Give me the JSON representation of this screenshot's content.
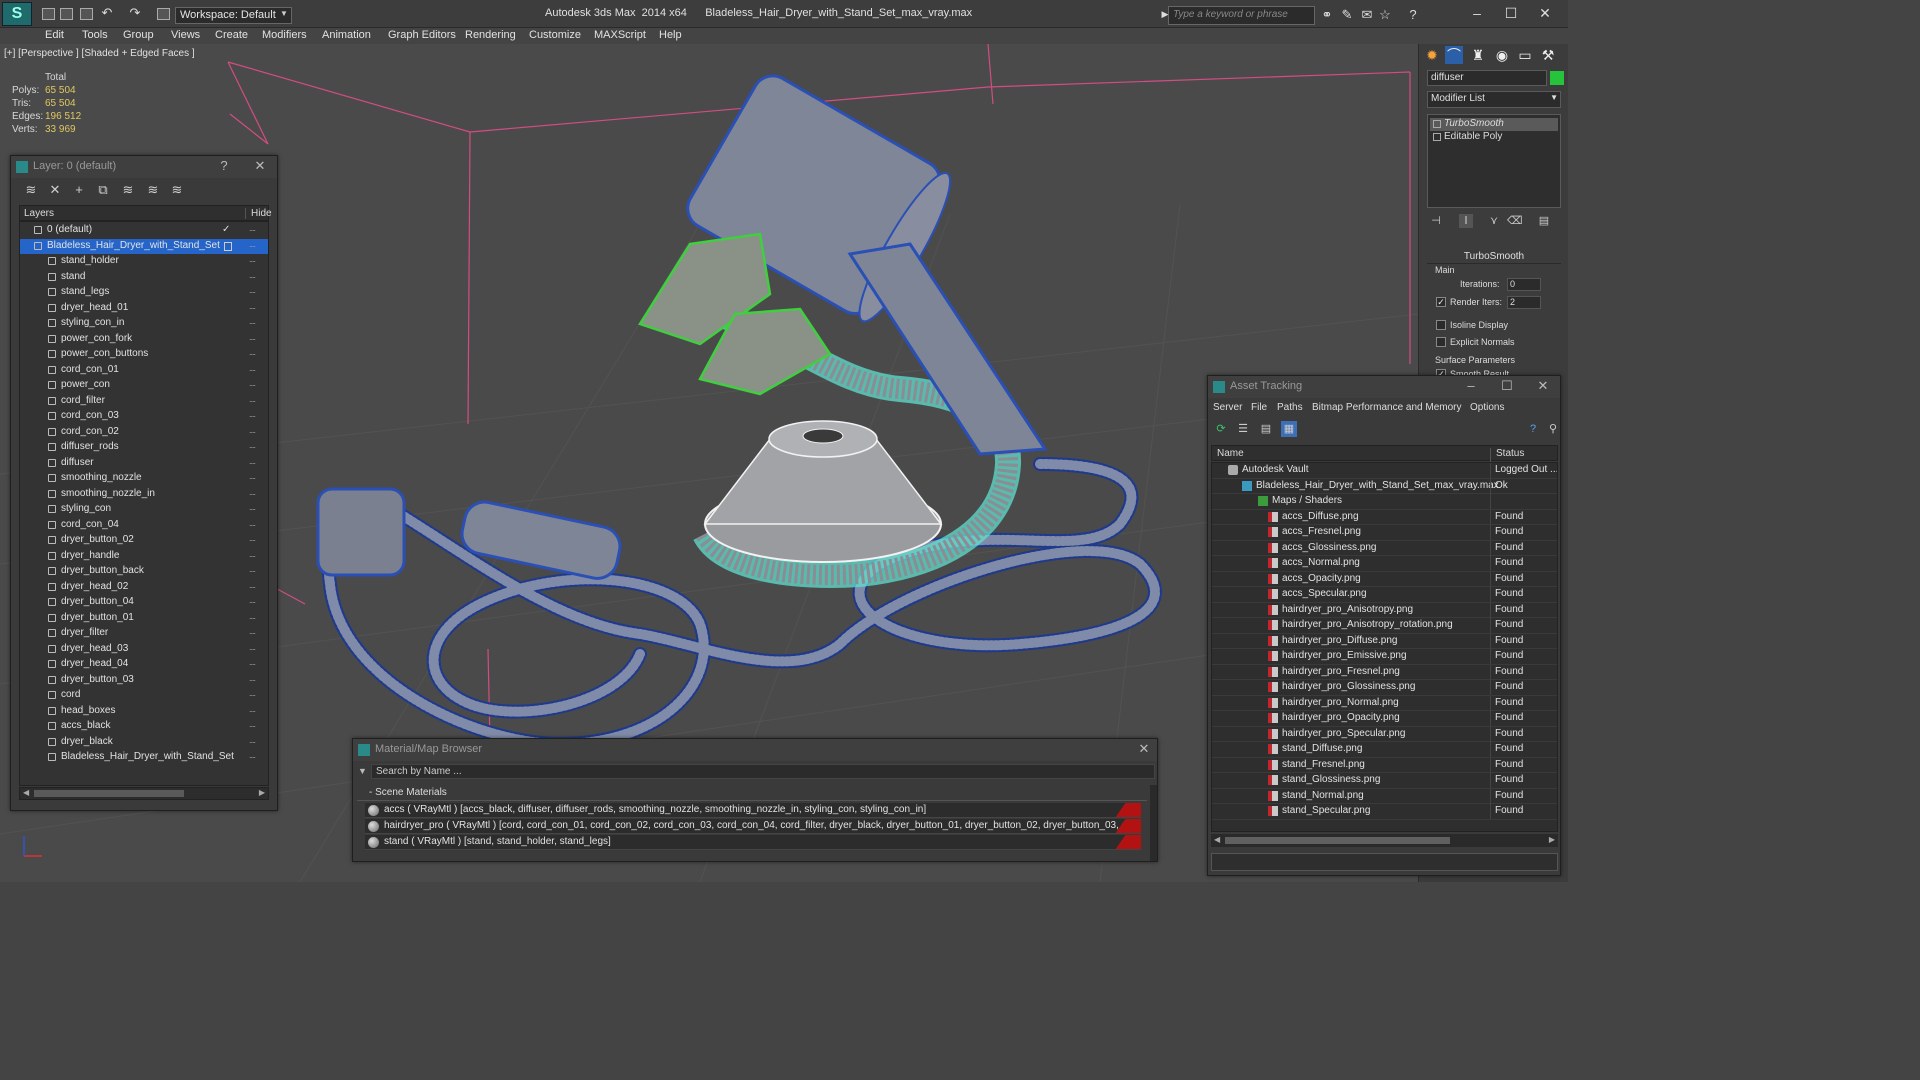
{
  "app": {
    "title": "Autodesk 3ds Max  2014 x64      Bladeless_Hair_Dryer_with_Stand_Set_max_vray.max",
    "workspace": "Workspace: Default",
    "search_placeholder": "Type a keyword or phrase"
  },
  "menu": [
    "Edit",
    "Tools",
    "Group",
    "Views",
    "Create",
    "Modifiers",
    "Animation",
    "Graph Editors",
    "Rendering",
    "Customize",
    "MAXScript",
    "Help"
  ],
  "viewport": {
    "label": "[+] [Perspective ] [Shaded + Edged Faces ]",
    "stats": {
      "header": "Total",
      "rows": [
        {
          "key": "Polys:",
          "value": "65 504"
        },
        {
          "key": "Tris:",
          "value": "65 504"
        },
        {
          "key": "Edges:",
          "value": "196 512"
        },
        {
          "key": "Verts:",
          "value": "33 969"
        }
      ]
    },
    "colors": {
      "background": "#4a4a4a",
      "green_wire": "#3fcf3f",
      "teal_wire": "#5fe0cf",
      "blue_wire": "#2a5ac8",
      "grid": "#d24d82"
    }
  },
  "command_panel": {
    "object_name": "diffuser",
    "object_color": "#26c43a",
    "modifier_list": "Modifier List",
    "stack": [
      "TurboSmooth",
      "Editable Poly"
    ],
    "rollout_title": "TurboSmooth",
    "main_label": "Main",
    "iterations_label": "Iterations:",
    "iterations_value": "0",
    "render_iters_label": "Render Iters:",
    "render_iters_value": "2",
    "isoline_label": "Isoline Display",
    "explicit_normals_label": "Explicit Normals",
    "surface_params_label": "Surface Parameters",
    "smooth_result_label": "Smooth Result"
  },
  "layer_window": {
    "title": "Layer: 0 (default)",
    "help": "?",
    "col_layers": "Layers",
    "col_hide": "Hide",
    "hide_mark": "....",
    "rows": [
      {
        "name": "0 (default)",
        "level": 0,
        "check": "✓"
      },
      {
        "name": "Bladeless_Hair_Dryer_with_Stand_Set",
        "level": 0,
        "selected": true
      },
      {
        "name": "stand_holder",
        "level": 1
      },
      {
        "name": "stand",
        "level": 1
      },
      {
        "name": "stand_legs",
        "level": 1
      },
      {
        "name": "dryer_head_01",
        "level": 1
      },
      {
        "name": "styling_con_in",
        "level": 1
      },
      {
        "name": "power_con_fork",
        "level": 1
      },
      {
        "name": "power_con_buttons",
        "level": 1
      },
      {
        "name": "cord_con_01",
        "level": 1
      },
      {
        "name": "power_con",
        "level": 1
      },
      {
        "name": "cord_filter",
        "level": 1
      },
      {
        "name": "cord_con_03",
        "level": 1
      },
      {
        "name": "cord_con_02",
        "level": 1
      },
      {
        "name": "diffuser_rods",
        "level": 1
      },
      {
        "name": "diffuser",
        "level": 1
      },
      {
        "name": "smoothing_nozzle",
        "level": 1
      },
      {
        "name": "smoothing_nozzle_in",
        "level": 1
      },
      {
        "name": "styling_con",
        "level": 1
      },
      {
        "name": "cord_con_04",
        "level": 1
      },
      {
        "name": "dryer_button_02",
        "level": 1
      },
      {
        "name": "dryer_handle",
        "level": 1
      },
      {
        "name": "dryer_button_back",
        "level": 1
      },
      {
        "name": "dryer_head_02",
        "level": 1
      },
      {
        "name": "dryer_button_04",
        "level": 1
      },
      {
        "name": "dryer_button_01",
        "level": 1
      },
      {
        "name": "dryer_filter",
        "level": 1
      },
      {
        "name": "dryer_head_03",
        "level": 1
      },
      {
        "name": "dryer_head_04",
        "level": 1
      },
      {
        "name": "dryer_button_03",
        "level": 1
      },
      {
        "name": "cord",
        "level": 1
      },
      {
        "name": "head_boxes",
        "level": 1
      },
      {
        "name": "accs_black",
        "level": 1
      },
      {
        "name": "dryer_black",
        "level": 1
      },
      {
        "name": "Bladeless_Hair_Dryer_with_Stand_Set",
        "level": 1
      }
    ]
  },
  "material_browser": {
    "title": "Material/Map Browser",
    "search_placeholder": "Search by Name ...",
    "section": "- Scene Materials",
    "rows": [
      "accs ( VRayMtl ) [accs_black, diffuser, diffuser_rods, smoothing_nozzle, smoothing_nozzle_in, styling_con, styling_con_in]",
      "hairdryer_pro ( VRayMtl ) [cord, cord_con_01, cord_con_02, cord_con_03, cord_con_04, cord_filter, dryer_black, dryer_button_01, dryer_button_02, dryer_button_03, dryer_button...",
      "stand ( VRayMtl ) [stand, stand_holder, stand_legs]"
    ]
  },
  "asset_tracking": {
    "title": "Asset Tracking",
    "menu": [
      "Server",
      "File",
      "Paths",
      "Bitmap Performance and Memory",
      "Options"
    ],
    "col_name": "Name",
    "col_status": "Status",
    "rows": [
      {
        "name": "Autodesk Vault",
        "status": "Logged Out ...",
        "level": 0,
        "icon": "vault"
      },
      {
        "name": "Bladeless_Hair_Dryer_with_Stand_Set_max_vray.max",
        "status": "Ok",
        "level": 1,
        "icon": "max"
      },
      {
        "name": "Maps / Shaders",
        "status": "",
        "level": 2,
        "icon": "folder"
      },
      {
        "name": "accs_Diffuse.png",
        "status": "Found",
        "level": 3,
        "icon": "png"
      },
      {
        "name": "accs_Fresnel.png",
        "status": "Found",
        "level": 3,
        "icon": "png"
      },
      {
        "name": "accs_Glossiness.png",
        "status": "Found",
        "level": 3,
        "icon": "png"
      },
      {
        "name": "accs_Normal.png",
        "status": "Found",
        "level": 3,
        "icon": "png"
      },
      {
        "name": "accs_Opacity.png",
        "status": "Found",
        "level": 3,
        "icon": "png"
      },
      {
        "name": "accs_Specular.png",
        "status": "Found",
        "level": 3,
        "icon": "png"
      },
      {
        "name": "hairdryer_pro_Anisotropy.png",
        "status": "Found",
        "level": 3,
        "icon": "png"
      },
      {
        "name": "hairdryer_pro_Anisotropy_rotation.png",
        "status": "Found",
        "level": 3,
        "icon": "png"
      },
      {
        "name": "hairdryer_pro_Diffuse.png",
        "status": "Found",
        "level": 3,
        "icon": "png"
      },
      {
        "name": "hairdryer_pro_Emissive.png",
        "status": "Found",
        "level": 3,
        "icon": "png"
      },
      {
        "name": "hairdryer_pro_Fresnel.png",
        "status": "Found",
        "level": 3,
        "icon": "png"
      },
      {
        "name": "hairdryer_pro_Glossiness.png",
        "status": "Found",
        "level": 3,
        "icon": "png"
      },
      {
        "name": "hairdryer_pro_Normal.png",
        "status": "Found",
        "level": 3,
        "icon": "png"
      },
      {
        "name": "hairdryer_pro_Opacity.png",
        "status": "Found",
        "level": 3,
        "icon": "png"
      },
      {
        "name": "hairdryer_pro_Specular.png",
        "status": "Found",
        "level": 3,
        "icon": "png"
      },
      {
        "name": "stand_Diffuse.png",
        "status": "Found",
        "level": 3,
        "icon": "png"
      },
      {
        "name": "stand_Fresnel.png",
        "status": "Found",
        "level": 3,
        "icon": "png"
      },
      {
        "name": "stand_Glossiness.png",
        "status": "Found",
        "level": 3,
        "icon": "png"
      },
      {
        "name": "stand_Normal.png",
        "status": "Found",
        "level": 3,
        "icon": "png"
      },
      {
        "name": "stand_Specular.png",
        "status": "Found",
        "level": 3,
        "icon": "png"
      }
    ]
  }
}
